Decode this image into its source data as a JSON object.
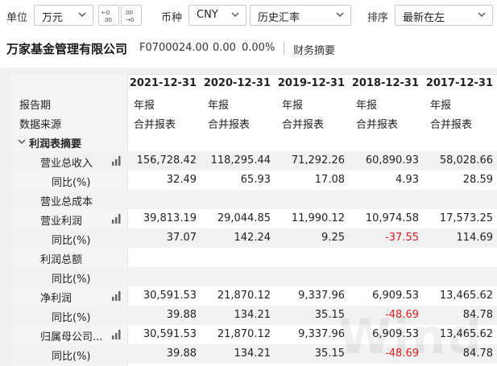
{
  "toolbar": {
    "unit_label": "单位",
    "unit_value": "万元",
    "currency_label": "币种",
    "currency_value": "CNY",
    "rate_value": "历史汇率",
    "sort_label": "排序",
    "sort_value": "最新在左",
    "decimal_increase_icon": "decimal-increase-icon",
    "decimal_decrease_icon": "decimal-decrease-icon"
  },
  "header": {
    "company": "万家基金管理有限公司",
    "code": "F0700024.00",
    "price": "0.00",
    "change": "0.00%",
    "tab": "财务摘要"
  },
  "table": {
    "columns": [
      "2021-12-31",
      "2020-12-31",
      "2019-12-31",
      "2018-12-31",
      "2017-12-31"
    ],
    "report_period_label": "报告期",
    "report_period_values": [
      "年报",
      "年报",
      "年报",
      "年报",
      "年报"
    ],
    "data_source_label": "数据来源",
    "data_source_values": [
      "合并报表",
      "合并报表",
      "合并报表",
      "合并报表",
      "合并报表"
    ],
    "section_label": "利润表摘要",
    "rows": [
      {
        "label": "营业总收入",
        "chart": true,
        "values": [
          "156,728.42",
          "118,295.44",
          "71,292.26",
          "60,890.93",
          "58,028.66"
        ]
      },
      {
        "label": "同比(%)",
        "chart": false,
        "values": [
          "32.49",
          "65.93",
          "17.08",
          "4.93",
          "28.59"
        ]
      },
      {
        "label": "营业总成本",
        "chart": false,
        "values": [
          "",
          "",
          "",
          "",
          ""
        ]
      },
      {
        "label": "营业利润",
        "chart": true,
        "values": [
          "39,813.19",
          "29,044.85",
          "11,990.12",
          "10,974.58",
          "17,573.25"
        ]
      },
      {
        "label": "同比(%)",
        "chart": false,
        "values": [
          "37.07",
          "142.24",
          "9.25",
          "-37.55",
          "114.69"
        ]
      },
      {
        "label": "利润总额",
        "chart": false,
        "values": [
          "",
          "",
          "",
          "",
          ""
        ]
      },
      {
        "label": "同比(%)",
        "chart": false,
        "values": [
          "",
          "",
          "",
          "",
          ""
        ]
      },
      {
        "label": "净利润",
        "chart": true,
        "values": [
          "30,591.53",
          "21,870.12",
          "9,337.96",
          "6,909.53",
          "13,465.62"
        ]
      },
      {
        "label": "同比(%)",
        "chart": false,
        "values": [
          "39.88",
          "134.21",
          "35.15",
          "-48.69",
          "84.78"
        ]
      },
      {
        "label": "归属母公司...",
        "chart": true,
        "values": [
          "30,591.53",
          "21,870.12",
          "9,337.96",
          "6,909.53",
          "13,465.62"
        ]
      },
      {
        "label": "同比(%)",
        "chart": false,
        "values": [
          "39.88",
          "134.21",
          "35.15",
          "-48.69",
          "84.78"
        ]
      }
    ]
  },
  "colors": {
    "negative": "#e02020",
    "shade": "#f2f2f2",
    "bars_icon": "#666666"
  },
  "watermark": "Wind"
}
